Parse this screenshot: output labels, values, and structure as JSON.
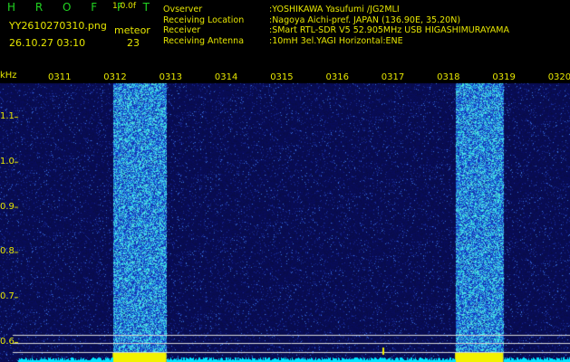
{
  "header": {
    "logo": "H R O F F T",
    "version": "1.0.0f",
    "filename": "YY2610270310.png",
    "datetime": "26.10.27 03:10",
    "meteor_label": "meteor",
    "meteor_count": "23"
  },
  "station": [
    {
      "key": "Ovserver",
      "value": ":YOSHIKAWA Yasufumi /JG2MLI"
    },
    {
      "key": "Receiving Location",
      "value": ":Nagoya Aichi-pref. JAPAN (136.90E, 35.20N)"
    },
    {
      "key": "Receiver",
      "value": ":SMart RTL-SDR V5 52.905MHz USB HIGASHIMURAYAMA"
    },
    {
      "key": "Receiving Antenna",
      "value": ":10mH 3el.YAGI Horizontal:ENE"
    }
  ],
  "spectrogram": {
    "y_unit": "kHz",
    "y_ticks": [
      "1.1",
      "1.0",
      "0.9",
      "0.8",
      "0.7",
      "0.6"
    ],
    "x_ticks": [
      "0311",
      "0312",
      "0313",
      "0314",
      "0315",
      "0316",
      "0317",
      "0318",
      "0319",
      "0320"
    ],
    "colors": {
      "background": "#080c52",
      "noise_bright": "#2fd0e0",
      "noise_mid": "#3a5cd8",
      "baseline": "#00e5ff",
      "marker": "#f2f200",
      "hline": "#d8d8d8",
      "label": "#e6e600"
    },
    "chart_data": {
      "type": "heatmap",
      "xlabel": "",
      "ylabel": "kHz",
      "x_range": [
        "0311",
        "0320"
      ],
      "y_range_khz": [
        0.6,
        1.15
      ],
      "bright_bands_minutes": [
        [
          "03:12",
          "03:13"
        ],
        [
          "03:18.6",
          "03:19.4"
        ]
      ],
      "signal_strength_note": ""
    }
  }
}
